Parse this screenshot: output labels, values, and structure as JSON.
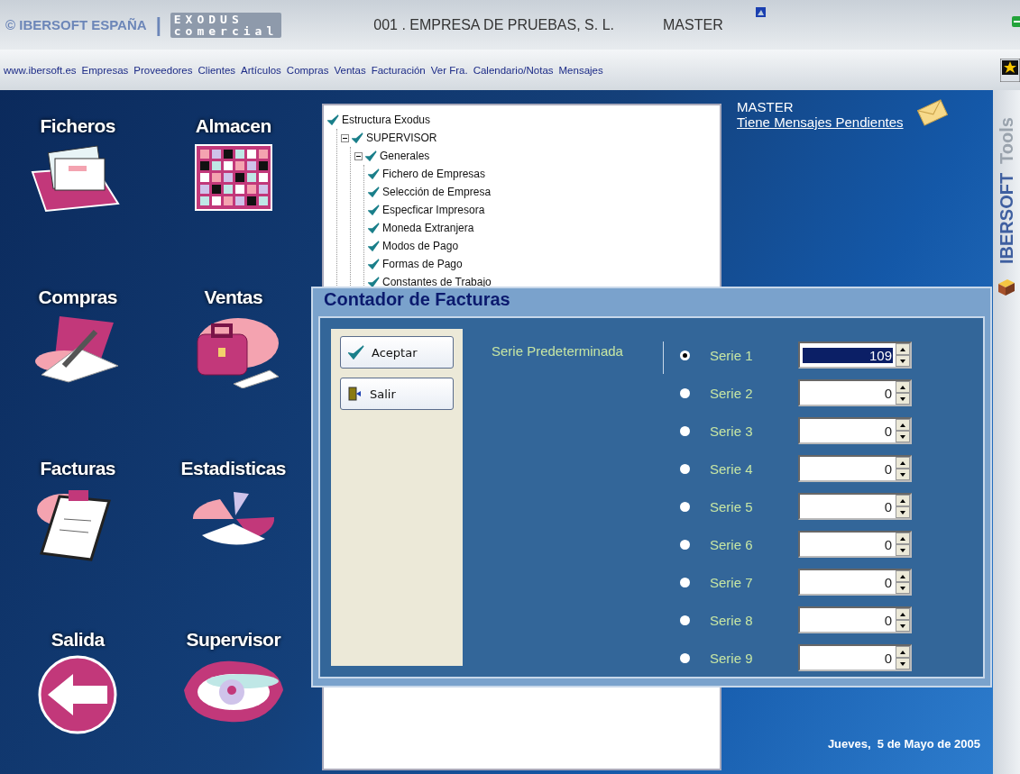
{
  "header": {
    "brand": "© IBERSOFT ESPAÑA",
    "separator": "|",
    "product_top": "EXODUS",
    "product_bottom": "comercial",
    "company": "001 . EMPRESA DE PRUEBAS, S. L.",
    "user": "MASTER"
  },
  "nav": [
    "www.ibersoft.es",
    "Empresas",
    "Proveedores",
    "Clientes",
    "Artículos",
    "Compras",
    "Ventas",
    "Facturación",
    "Ver Fra.",
    "Calendario/Notas",
    "Mensajes"
  ],
  "modules": [
    {
      "label": "Ficheros"
    },
    {
      "label": "Almacen"
    },
    {
      "label": "Compras"
    },
    {
      "label": "Ventas"
    },
    {
      "label": "Facturas"
    },
    {
      "label": "Estadisticas"
    },
    {
      "label": "Salida"
    },
    {
      "label": "Supervisor"
    }
  ],
  "tree": [
    {
      "label": "Estructura Exodus",
      "checked": true,
      "children": [
        {
          "label": "SUPERVISOR",
          "checked": true,
          "expanded": true,
          "children": [
            {
              "label": "Generales",
              "checked": true,
              "expanded": true,
              "children": [
                {
                  "label": "Fichero de Empresas",
                  "checked": true
                },
                {
                  "label": "Selección de Empresa",
                  "checked": true
                },
                {
                  "label": "Especficar Impresora",
                  "checked": true
                },
                {
                  "label": "Moneda Extranjera",
                  "checked": true
                },
                {
                  "label": "Modos de Pago",
                  "checked": true
                },
                {
                  "label": "Formas de Pago",
                  "checked": true
                },
                {
                  "label": "Constantes de Trabajo",
                  "checked": true
                }
              ]
            }
          ]
        }
      ]
    }
  ],
  "messages": {
    "user": "MASTER",
    "link": "Tiene Mensajes Pendientes"
  },
  "date": "Jueves,  5 de Mayo de 2005",
  "side_strip": {
    "brand": "IBERSOFT",
    "label": "Tools"
  },
  "dialog": {
    "title": "Contador de Facturas",
    "buttons": [
      {
        "label": "Aceptar",
        "kind": "accept"
      },
      {
        "label": "Salir",
        "kind": "exit"
      }
    ],
    "group_label": "Serie Predeterminada",
    "series": [
      {
        "label": "Serie 1",
        "selected": true,
        "value": "109",
        "highlighted": true
      },
      {
        "label": "Serie 2",
        "selected": false,
        "value": "0",
        "highlighted": false
      },
      {
        "label": "Serie 3",
        "selected": false,
        "value": "0",
        "highlighted": false
      },
      {
        "label": "Serie 4",
        "selected": false,
        "value": "0",
        "highlighted": false
      },
      {
        "label": "Serie 5",
        "selected": false,
        "value": "0",
        "highlighted": false
      },
      {
        "label": "Serie 6",
        "selected": false,
        "value": "0",
        "highlighted": false
      },
      {
        "label": "Serie 7",
        "selected": false,
        "value": "0",
        "highlighted": false
      },
      {
        "label": "Serie 8",
        "selected": false,
        "value": "0",
        "highlighted": false
      },
      {
        "label": "Serie 9",
        "selected": false,
        "value": "0",
        "highlighted": false
      }
    ]
  }
}
